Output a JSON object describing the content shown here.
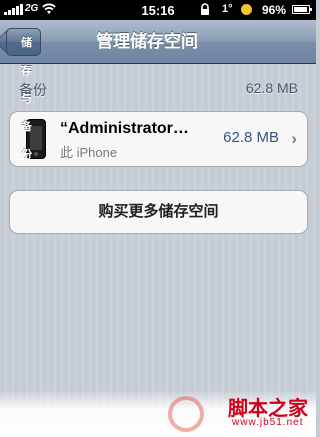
{
  "status_bar": {
    "network_label": "2G",
    "time": "15:16",
    "temperature": "1°",
    "battery_percent": "96%",
    "battery_level": 0.96,
    "icons": [
      "signal-icon",
      "wifi-icon",
      "lock-icon",
      "sun-icon",
      "battery-icon"
    ]
  },
  "nav": {
    "back_label": "储存与备份",
    "title": "管理储存空间"
  },
  "backup_section": {
    "header": "备份",
    "total_size": "62.8 MB",
    "device": {
      "name": "“Administrator…",
      "subtitle": "此 iPhone",
      "size": "62.8 MB",
      "chevron": "›"
    }
  },
  "buy_button": {
    "label": "购买更多储存空间"
  },
  "watermark": {
    "text": "脚本之家",
    "url": "www.jb51.net"
  },
  "colors": {
    "nav_blue": "#6e84a2",
    "detail_blue": "#385487",
    "watermark_red": "#d0021b"
  }
}
